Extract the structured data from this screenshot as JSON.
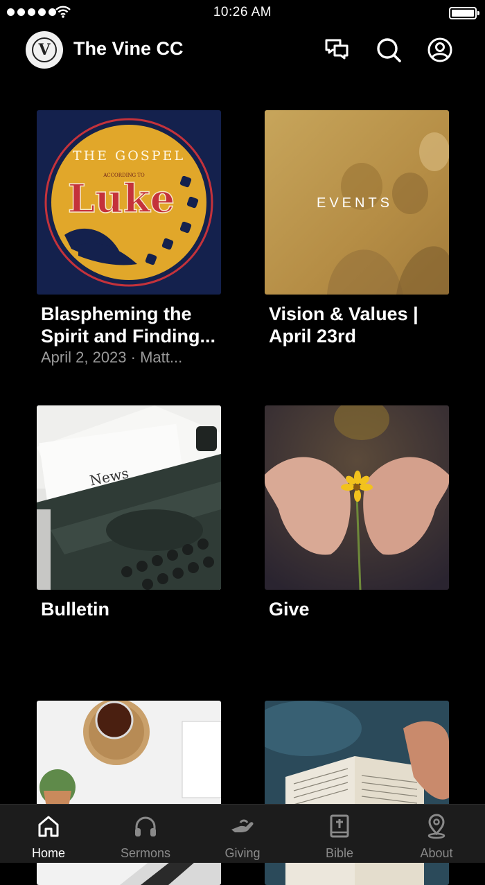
{
  "status_bar": {
    "time": "10:26 AM"
  },
  "header": {
    "logo_letter": "V",
    "title": "The Vine CC",
    "icons": [
      "chat-icon",
      "search-icon",
      "account-icon"
    ]
  },
  "cards": [
    {
      "title_line1": "Blaspheming the",
      "title_line2": "Spirit and Finding...",
      "subtitle": "April 2, 2023 · Matt...",
      "art": {
        "kicker": "THE GOSPEL",
        "small": "ACCORDING TO",
        "big": "Luke"
      }
    },
    {
      "title_line1": "Vision & Values |",
      "title_line2": "April 23rd",
      "art": {
        "overlay": "EVENTS"
      }
    },
    {
      "title_line1": "Bulletin",
      "art": {
        "paper_text": "News"
      }
    },
    {
      "title_line1": "Give"
    },
    {
      "title_line1": ""
    },
    {
      "title_line1": ""
    }
  ],
  "tabs": [
    {
      "label": "Home",
      "icon": "home-icon",
      "active": true
    },
    {
      "label": "Sermons",
      "icon": "headphones-icon",
      "active": false
    },
    {
      "label": "Giving",
      "icon": "giving-icon",
      "active": false
    },
    {
      "label": "Bible",
      "icon": "bible-icon",
      "active": false
    },
    {
      "label": "About",
      "icon": "location-pin-icon",
      "active": false
    }
  ],
  "colors": {
    "background": "#000000",
    "tabbar": "#1c1c1c",
    "inactive_tab": "#8a8a8a",
    "subtitle": "#9a9a9a"
  }
}
